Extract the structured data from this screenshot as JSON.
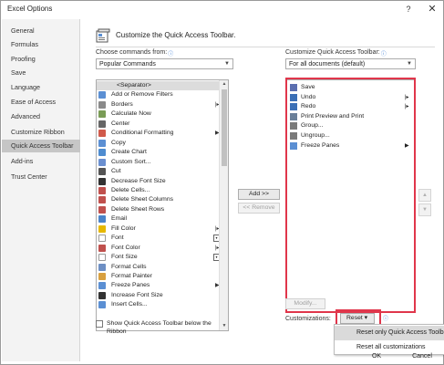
{
  "window": {
    "title": "Excel Options",
    "help": "?",
    "close": "✕"
  },
  "sidebar": {
    "items": [
      {
        "label": "General"
      },
      {
        "label": "Formulas"
      },
      {
        "label": "Proofing"
      },
      {
        "label": "Save"
      },
      {
        "label": "Language"
      },
      {
        "label": "Ease of Access"
      },
      {
        "label": "Advanced"
      },
      {
        "label": "Customize Ribbon"
      },
      {
        "label": "Quick Access Toolbar",
        "active": true
      },
      {
        "label": "Add-ins"
      },
      {
        "label": "Trust Center"
      }
    ]
  },
  "header": {
    "title": "Customize the Quick Access Toolbar."
  },
  "choose": {
    "label": "Choose commands from:",
    "value": "Popular Commands"
  },
  "customize": {
    "label": "Customize Quick Access Toolbar:",
    "value": "For all documents (default)"
  },
  "commands": [
    {
      "label": "<Separator>",
      "icon": "separator",
      "color": "#dcdcdc",
      "sep": true
    },
    {
      "label": "Add or Remove Filters",
      "icon": "filter",
      "color": "#5b8fd3"
    },
    {
      "label": "Borders",
      "icon": "borders",
      "color": "#8a8a8a",
      "submenu": "bar"
    },
    {
      "label": "Calculate Now",
      "icon": "calculator",
      "color": "#7a9c56"
    },
    {
      "label": "Center",
      "icon": "align-center",
      "color": "#666666"
    },
    {
      "label": "Conditional Formatting",
      "icon": "conditional-formatting",
      "color": "#d05a4b",
      "submenu": "arrow"
    },
    {
      "label": "Copy",
      "icon": "copy",
      "color": "#5b8fd3"
    },
    {
      "label": "Create Chart",
      "icon": "chart",
      "color": "#4e8cd0"
    },
    {
      "label": "Custom Sort...",
      "icon": "sort",
      "color": "#6a8fd0"
    },
    {
      "label": "Cut",
      "icon": "scissors",
      "color": "#555555"
    },
    {
      "label": "Decrease Font Size",
      "icon": "font-decrease",
      "color": "#333333"
    },
    {
      "label": "Delete Cells...",
      "icon": "delete-cells",
      "color": "#c0504d"
    },
    {
      "label": "Delete Sheet Columns",
      "icon": "delete-columns",
      "color": "#c0504d"
    },
    {
      "label": "Delete Sheet Rows",
      "icon": "delete-rows",
      "color": "#c0504d"
    },
    {
      "label": "Email",
      "icon": "email",
      "color": "#4a84c9"
    },
    {
      "label": "Fill Color",
      "icon": "fill-color",
      "color": "#e6b800",
      "submenu": "bar"
    },
    {
      "label": "Font",
      "icon": "font",
      "color": "#ffffff",
      "submenu": "box"
    },
    {
      "label": "Font Color",
      "icon": "font-color",
      "color": "#c0504d",
      "submenu": "bar"
    },
    {
      "label": "Font Size",
      "icon": "font-size",
      "color": "#ffffff",
      "submenu": "box"
    },
    {
      "label": "Format Cells",
      "icon": "format-cells",
      "color": "#6d8fc4"
    },
    {
      "label": "Format Painter",
      "icon": "format-painter",
      "color": "#d8a040"
    },
    {
      "label": "Freeze Panes",
      "icon": "freeze-panes",
      "color": "#5b8fd3",
      "submenu": "arrow"
    },
    {
      "label": "Increase Font Size",
      "icon": "font-increase",
      "color": "#333333"
    },
    {
      "label": "Insert Cells...",
      "icon": "insert-cells",
      "color": "#5b8fd3"
    }
  ],
  "toolbar_items": [
    {
      "label": "Save",
      "icon": "save",
      "color": "#5b6fb0"
    },
    {
      "label": "Undo",
      "icon": "undo",
      "color": "#3b6fb6",
      "submenu": "bar"
    },
    {
      "label": "Redo",
      "icon": "redo",
      "color": "#3b6fb6",
      "submenu": "bar"
    },
    {
      "label": "Print Preview and Print",
      "icon": "print-preview",
      "color": "#6a7f99"
    },
    {
      "label": "Group...",
      "icon": "group",
      "color": "#7a7a7a"
    },
    {
      "label": "Ungroup...",
      "icon": "ungroup",
      "color": "#7a7a7a"
    },
    {
      "label": "Freeze Panes",
      "icon": "freeze-panes",
      "color": "#5b8fd3",
      "submenu": "arrow"
    }
  ],
  "buttons": {
    "add": "Add >>",
    "remove": "<< Remove",
    "modify": "Modify...",
    "up": "▲",
    "down": "▼"
  },
  "checkbox": {
    "label": "Show Quick Access Toolbar below the Ribbon"
  },
  "customizations": {
    "label": "Customizations:",
    "reset": "Reset ▾"
  },
  "reset_menu": [
    {
      "label": "Reset only Quick Access Toolbar",
      "hover": true
    },
    {
      "label": "Reset all customizations"
    }
  ],
  "footer": {
    "ok": "OK",
    "cancel": "Cancel"
  },
  "colors": {
    "highlight": "#e0364b",
    "info": "#3a7bd5",
    "selected": "#c6c6c6"
  }
}
